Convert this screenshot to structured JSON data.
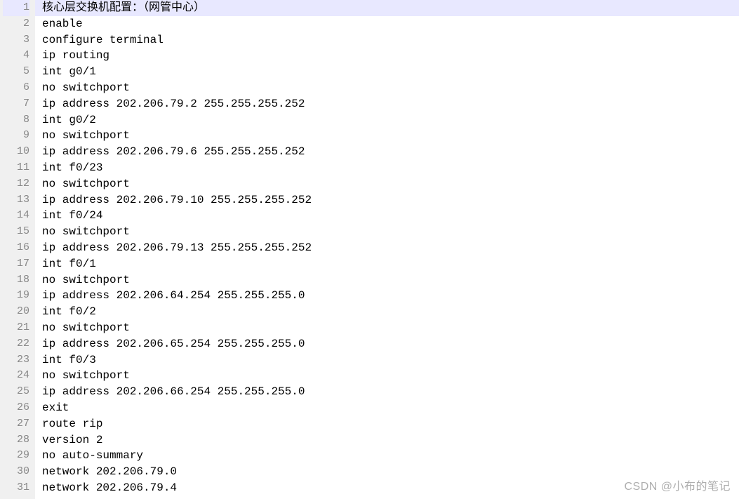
{
  "editor": {
    "current_line": 1,
    "lines": [
      "核心层交换机配置：（网管中心）",
      "enable",
      "configure terminal",
      "ip routing",
      "int g0/1",
      "no switchport",
      "ip address 202.206.79.2 255.255.255.252",
      "int g0/2",
      "no switchport",
      "ip address 202.206.79.6 255.255.255.252",
      "int f0/23",
      "no switchport",
      "ip address 202.206.79.10 255.255.255.252",
      "int f0/24",
      "no switchport",
      "ip address 202.206.79.13 255.255.255.252",
      "int f0/1",
      "no switchport",
      "ip address 202.206.64.254 255.255.255.0",
      "int f0/2",
      "no switchport",
      "ip address 202.206.65.254 255.255.255.0",
      "int f0/3",
      "no switchport",
      "ip address 202.206.66.254 255.255.255.0",
      "exit",
      "route rip",
      "version 2",
      "no auto-summary",
      "network 202.206.79.0",
      "network 202.206.79.4"
    ]
  },
  "watermark": "CSDN @小布的笔记"
}
